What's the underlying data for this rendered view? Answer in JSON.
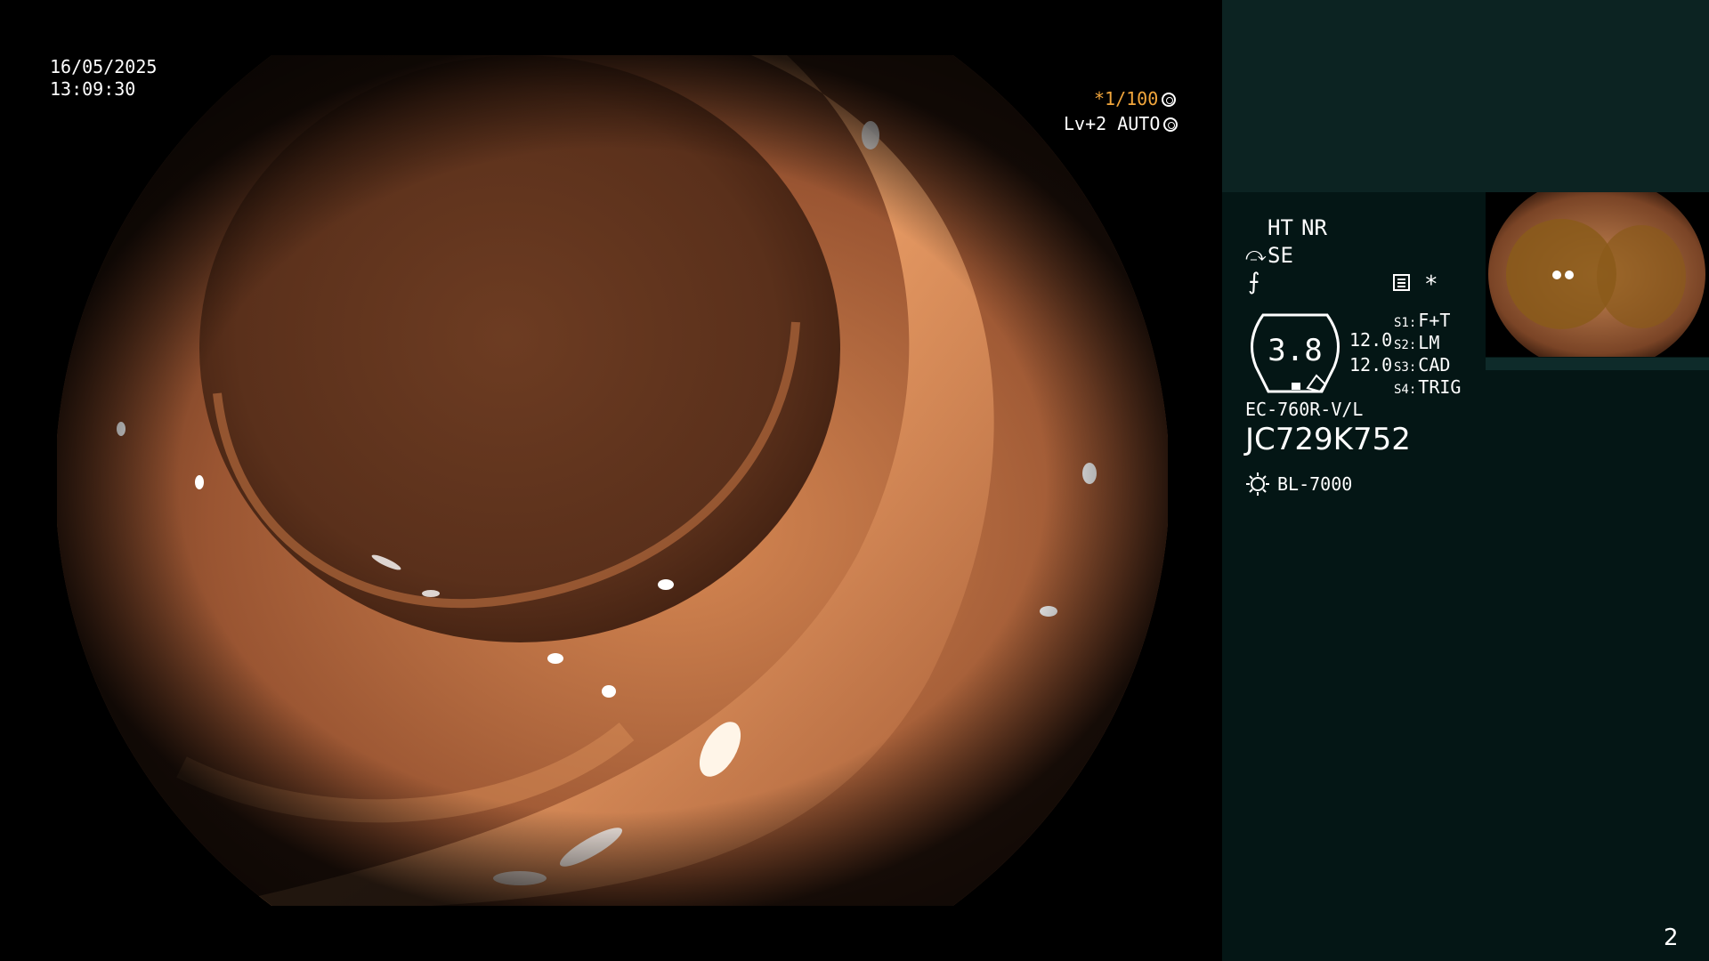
{
  "overlay": {
    "date": "16/05/2025",
    "time": "13:09:30",
    "shutter": "*1/100",
    "enhance": "Lv+2 AUTO"
  },
  "panel": {
    "ht": "HT",
    "nr": "NR",
    "se": "SE",
    "star": "*",
    "gauge_value": "3.8",
    "value_1": "12.0",
    "value_2": "12.0",
    "switches": [
      {
        "key": "S1:",
        "label": "F+T"
      },
      {
        "key": "S2:",
        "label": "LM"
      },
      {
        "key": "S3:",
        "label": "CAD"
      },
      {
        "key": "S4:",
        "label": "TRIG"
      }
    ],
    "scope_model": "EC-760R-V/L",
    "serial": "JC729K752",
    "light_source": "BL-7000",
    "page_number": "2"
  },
  "colors": {
    "accent_amber": "#f2a63c",
    "panel_bg": "#041615",
    "panel_top_bg": "#0c2322"
  },
  "icons": [
    "shutter-icon",
    "auto-icon",
    "se-icon",
    "f-icon",
    "menu-icon",
    "lamp-icon"
  ]
}
